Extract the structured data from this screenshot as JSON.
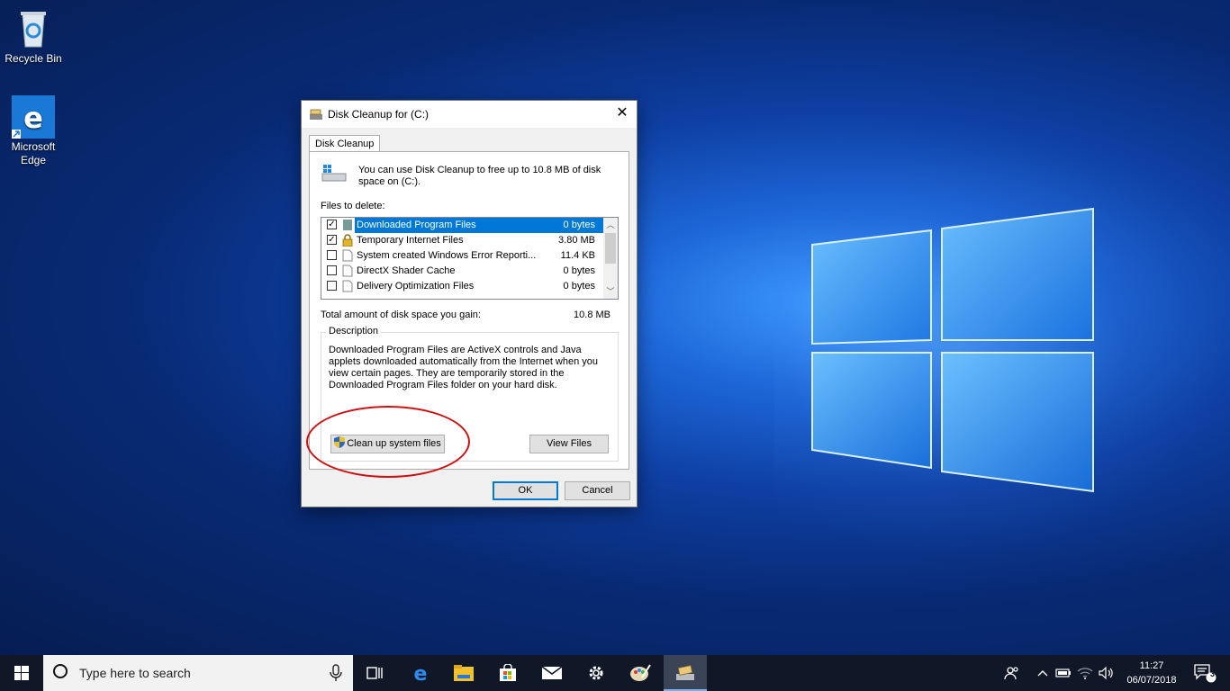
{
  "desktop": {
    "icons": [
      {
        "label": "Recycle Bin"
      },
      {
        "label_line1": "Microsoft",
        "label_line2": "Edge"
      }
    ]
  },
  "dialog": {
    "title": "Disk Cleanup for  (C:)",
    "close_glyph": "✕",
    "tab_label": "Disk Cleanup",
    "intro_text": "You can use Disk Cleanup to free up to 10.8 MB of disk space on  (C:).",
    "files_to_delete_label": "Files to delete:",
    "files": [
      {
        "name": "Downloaded Program Files",
        "size": "0 bytes",
        "checked": true,
        "selected": true
      },
      {
        "name": "Temporary Internet Files",
        "size": "3.80 MB",
        "checked": true,
        "selected": false
      },
      {
        "name": "System created Windows Error Reporti...",
        "size": "11.4 KB",
        "checked": false,
        "selected": false
      },
      {
        "name": "DirectX Shader Cache",
        "size": "0 bytes",
        "checked": false,
        "selected": false
      },
      {
        "name": "Delivery Optimization Files",
        "size": "0 bytes",
        "checked": false,
        "selected": false
      }
    ],
    "total_label": "Total amount of disk space you gain:",
    "total_value": "10.8 MB",
    "description_title": "Description",
    "description_text": "Downloaded Program Files are ActiveX controls and Java applets downloaded automatically from the Internet when you view certain pages. They are temporarily stored in the Downloaded Program Files folder on your hard disk.",
    "cleanup_system_label": "Clean up system files",
    "view_files_label": "View Files",
    "ok_label": "OK",
    "cancel_label": "Cancel",
    "checkmark": "✓"
  },
  "taskbar": {
    "search_placeholder": "Type here to search",
    "clock_time": "11:27",
    "clock_date": "06/07/2018",
    "notification_count": "3",
    "pinned_icons": [
      "task-view-icon",
      "edge-icon",
      "file-explorer-icon",
      "store-icon",
      "mail-icon",
      "settings-icon",
      "paint-icon",
      "disk-cleanup-icon"
    ]
  },
  "colors": {
    "accent": "#0078d7",
    "taskbar": "#101828",
    "annotation": "#d01010"
  }
}
